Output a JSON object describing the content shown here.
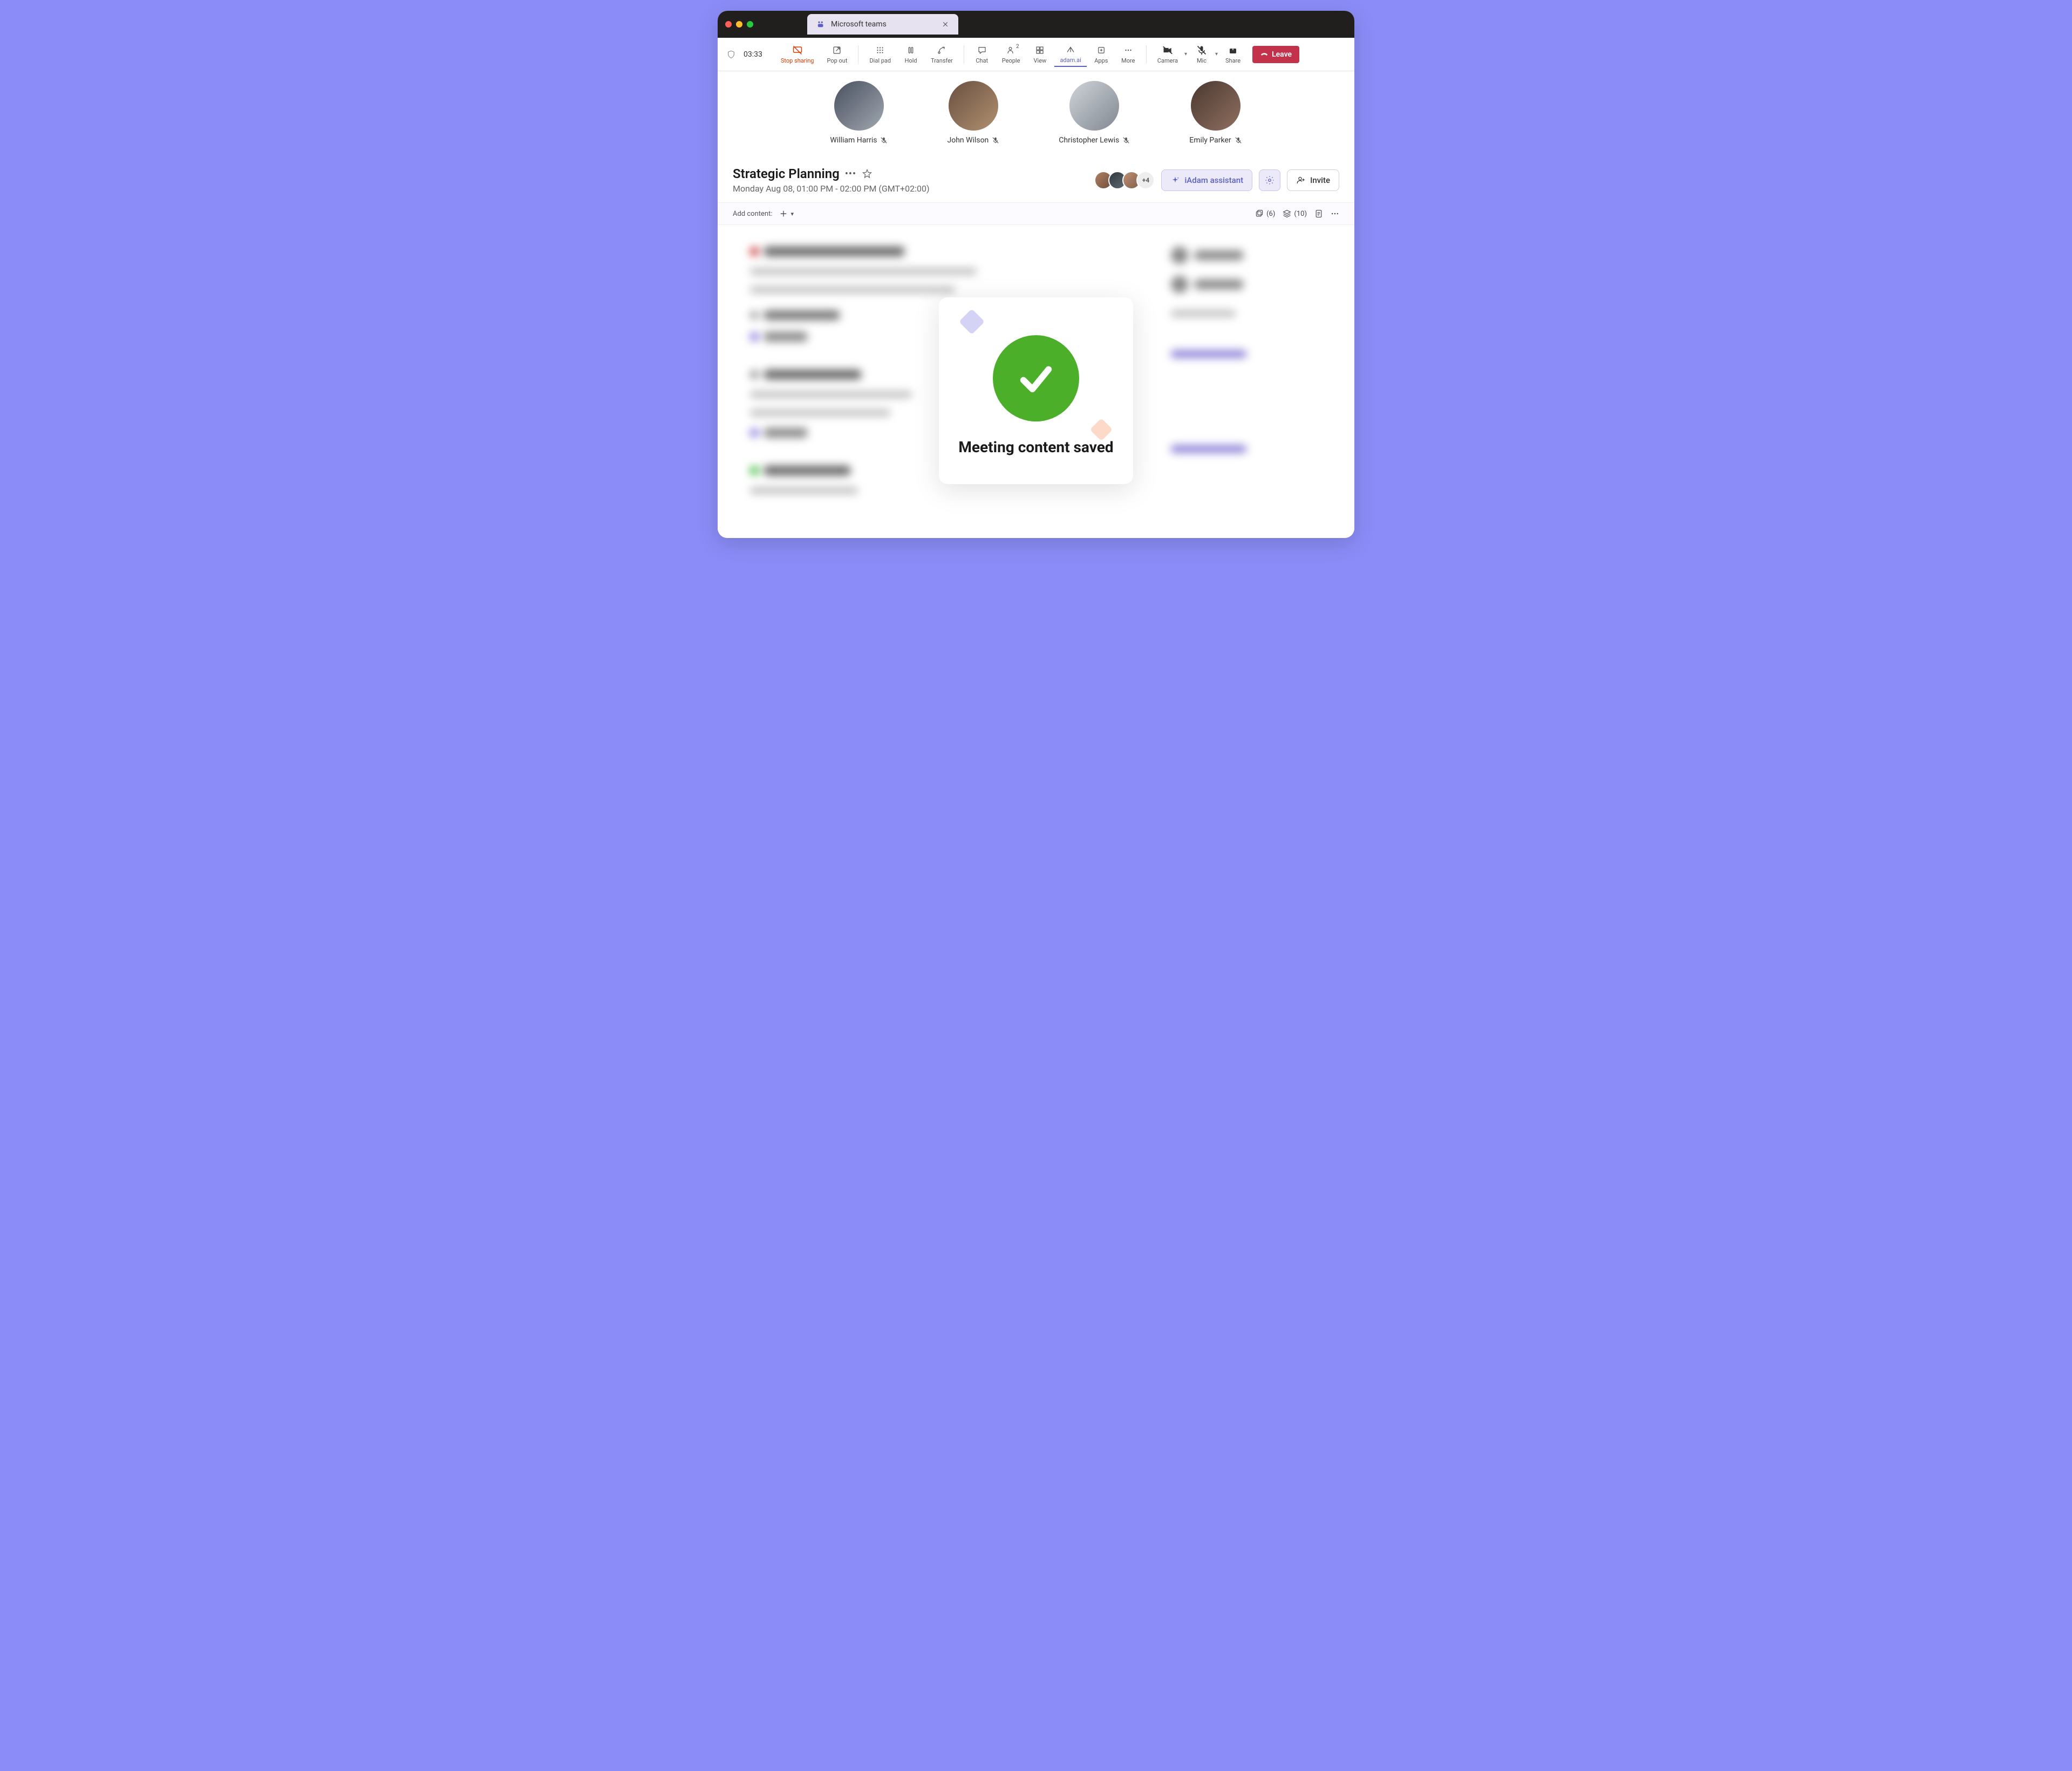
{
  "window": {
    "tab_title": "Microsoft teams"
  },
  "toolbar": {
    "time": "03:33",
    "stop_sharing": "Stop sharing",
    "pop_out": "Pop out",
    "dial_pad": "Dial pad",
    "hold": "Hold",
    "transfer": "Transfer",
    "chat": "Chat",
    "people": "People",
    "people_count": "2",
    "view": "View",
    "adam_ai": "adam.ai",
    "apps": "Apps",
    "more": "More",
    "camera": "Camera",
    "mic": "Mic",
    "share": "Share",
    "leave": "Leave"
  },
  "participants": [
    {
      "name": "William Harris",
      "muted": true
    },
    {
      "name": "John Wilson",
      "muted": true
    },
    {
      "name": "Christopher Lewis",
      "muted": true
    },
    {
      "name": "Emily Parker",
      "muted": true
    }
  ],
  "meeting": {
    "title": "Strategic Planning",
    "subtitle": "Monday Aug 08, 01:00 PM - 02:00 PM (GMT+02:00)",
    "extra_count": "+4",
    "assistant_label": "iAdam assistant",
    "invite_label": "Invite"
  },
  "content_bar": {
    "label": "Add content:",
    "count1": "(6)",
    "count2": "(10)"
  },
  "modal": {
    "message": "Meeting content saved"
  },
  "colors": {
    "accent": "#5b5fc7",
    "danger": "#d83b01",
    "leave": "#c4314b",
    "success": "#4caf2a"
  }
}
